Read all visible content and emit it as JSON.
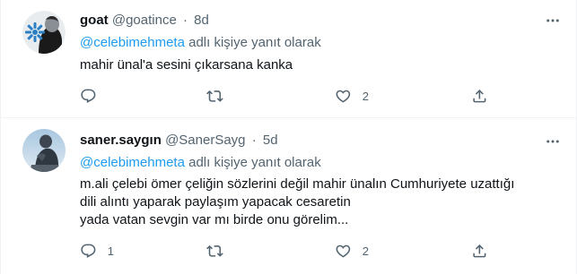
{
  "tweets": [
    {
      "name": "goat",
      "handle": "@goatince",
      "separator": "·",
      "time": "8d",
      "reply_mention": "@celebimehmeta",
      "reply_suffix": "adlı kişiye yanıt olarak",
      "text_lines": [
        "mahir ünal'a sesini çıkarsana kanka"
      ],
      "reply_count": "",
      "retweet_count": "",
      "like_count": "2"
    },
    {
      "name": "saner.saygın",
      "handle": "@SanerSayg",
      "separator": "·",
      "time": "5d",
      "reply_mention": "@celebimehmeta",
      "reply_suffix": "adlı kişiye yanıt olarak",
      "text_lines": [
        "m.ali çelebi ömer çeliğin  sözlerini değil mahir ünalın Cumhuriyete uzattığı",
        "dili alıntı yaparak paylaşım yapacak cesaretin",
        "yada vatan sevgin var mı birde onu görelim..."
      ],
      "reply_count": "1",
      "retweet_count": "",
      "like_count": "2"
    }
  ],
  "icons": {
    "reply": "reply-icon",
    "retweet": "retweet-icon",
    "like": "heart-icon",
    "share": "share-icon",
    "more": "more-icon"
  },
  "colors": {
    "link": "#1d9bf0",
    "secondary_text": "#536471",
    "primary_text": "#0f1419",
    "divider": "#eff3f4"
  }
}
